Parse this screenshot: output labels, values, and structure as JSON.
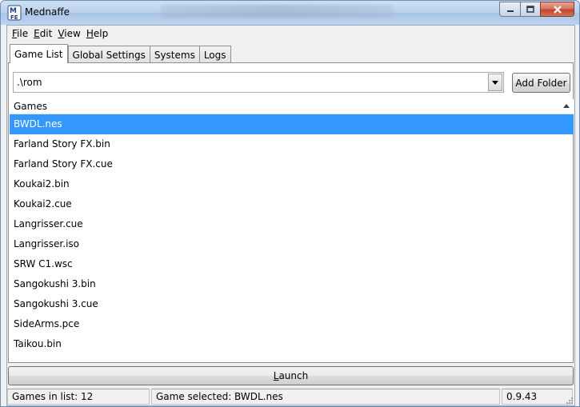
{
  "window": {
    "title": "Mednaffe",
    "icon_letters": [
      "M",
      "FE"
    ]
  },
  "menu": [
    {
      "mnemonic": "F",
      "rest": "ile"
    },
    {
      "mnemonic": "E",
      "rest": "dit"
    },
    {
      "mnemonic": "V",
      "rest": "iew"
    },
    {
      "mnemonic": "H",
      "rest": "elp"
    }
  ],
  "tabs": [
    {
      "label": "Game List",
      "active": true
    },
    {
      "label": "Global Settings",
      "active": false
    },
    {
      "label": "Systems",
      "active": false
    },
    {
      "label": "Logs",
      "active": false
    }
  ],
  "folder": {
    "path": ".\\rom",
    "add_label": "Add Folder"
  },
  "games_list": {
    "header": "Games",
    "items": [
      {
        "name": "BWDL.nes",
        "selected": true
      },
      {
        "name": "Farland Story FX.bin",
        "selected": false
      },
      {
        "name": "Farland Story FX.cue",
        "selected": false
      },
      {
        "name": "Koukai2.bin",
        "selected": false
      },
      {
        "name": "Koukai2.cue",
        "selected": false
      },
      {
        "name": "Langrisser.cue",
        "selected": false
      },
      {
        "name": "Langrisser.iso",
        "selected": false
      },
      {
        "name": "SRW C1.wsc",
        "selected": false
      },
      {
        "name": "Sangokushi 3.bin",
        "selected": false
      },
      {
        "name": "Sangokushi 3.cue",
        "selected": false
      },
      {
        "name": "SideArms.pce",
        "selected": false
      },
      {
        "name": "Taikou.bin",
        "selected": false
      }
    ]
  },
  "launch": {
    "mnemonic": "L",
    "rest": "aunch"
  },
  "status": {
    "games_count": "Games in list: 12",
    "selected": "Game selected: BWDL.nes",
    "version": "0.9.43"
  },
  "colors": {
    "selection": "#3399ff",
    "titlebar": "#b9d1ec",
    "close_button": "#c0462c"
  }
}
